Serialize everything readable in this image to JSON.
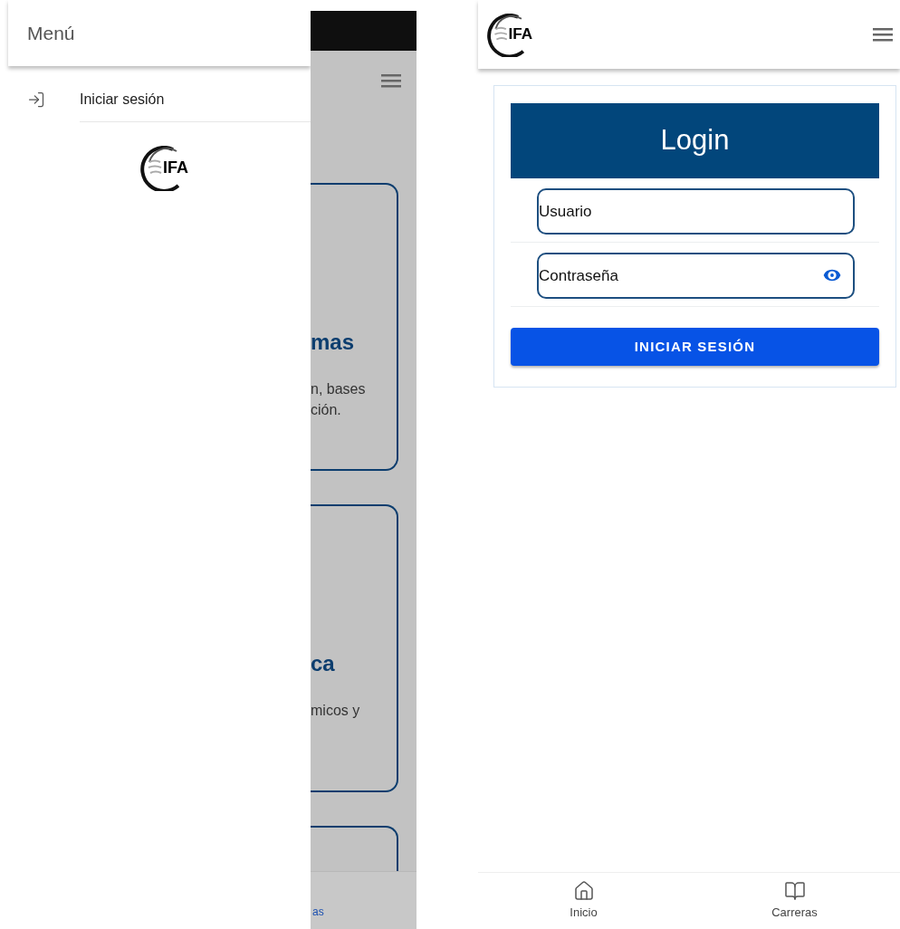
{
  "drawer": {
    "title": "Menú",
    "items": [
      {
        "label": "Iniciar sesión",
        "kind": "login"
      }
    ],
    "logo_text": "IFA"
  },
  "background_page": {
    "cards": [
      {
        "title": "mas",
        "lines": [
          "n, bases",
          "ción."
        ]
      },
      {
        "title": "ca",
        "lines": [
          "micos y"
        ]
      }
    ],
    "bottom_nav_label": "as"
  },
  "header": {
    "logo_text": "IFA"
  },
  "login": {
    "title": "Login",
    "fields": [
      {
        "placeholder": "Usuario",
        "kind": "text"
      },
      {
        "placeholder": "Contraseña",
        "kind": "password"
      }
    ],
    "button": "INICIAR SESIÓN"
  },
  "bottom_nav": [
    {
      "label": "Inicio",
      "kind": "home"
    },
    {
      "label": "Carreras",
      "kind": "book"
    }
  ]
}
